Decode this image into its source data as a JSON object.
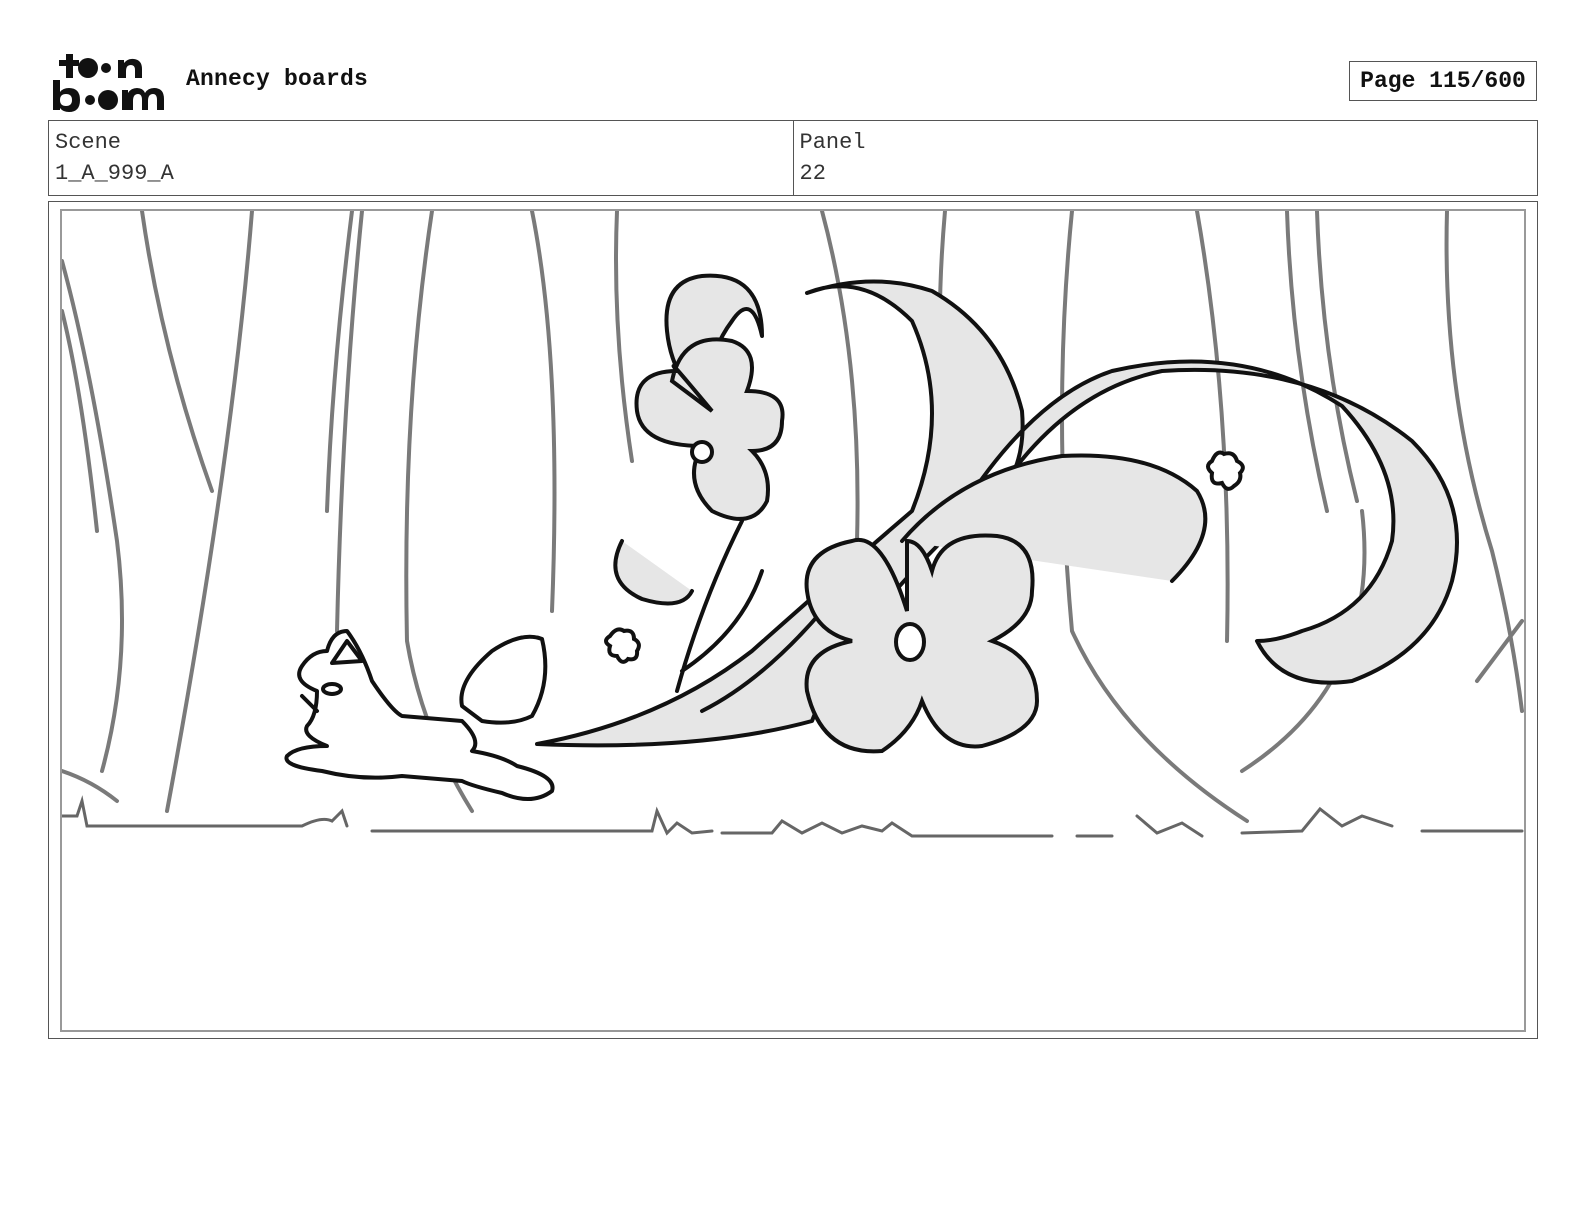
{
  "header": {
    "logo_text": [
      "toon",
      "boom"
    ],
    "title": "Annecy boards",
    "page_label": "Page 115/600"
  },
  "info": {
    "scene_label": "Scene",
    "scene_value": "1_A_999_A",
    "panel_label": "Panel",
    "panel_value": "22"
  },
  "drawing": {
    "description_icons": [
      "tree-trunks",
      "fox-icon",
      "flower-icon",
      "swirl-trail"
    ],
    "colors": {
      "ink": "#111111",
      "tree": "#7a7a7a",
      "fill": "#e6e6e6"
    }
  }
}
